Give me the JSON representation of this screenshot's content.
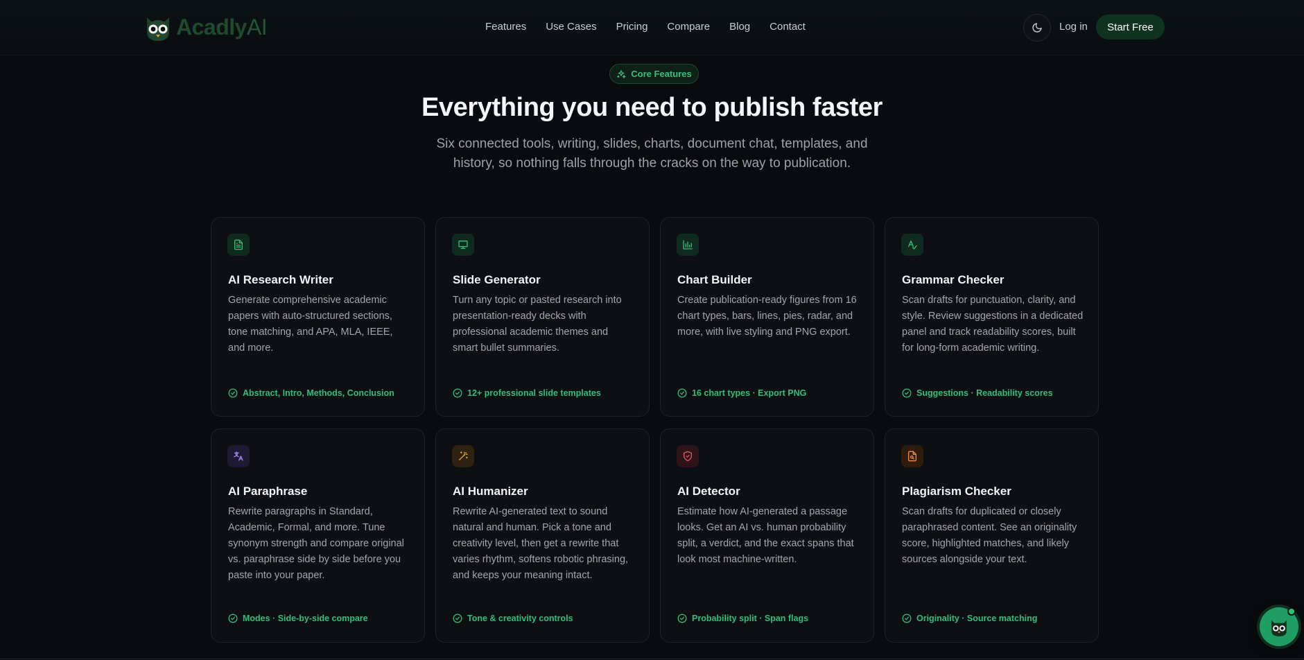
{
  "brand": {
    "name_main": "Acadly",
    "name_suffix": "AI"
  },
  "nav": {
    "items": [
      {
        "label": "Features"
      },
      {
        "label": "Use Cases"
      },
      {
        "label": "Pricing"
      },
      {
        "label": "Compare"
      },
      {
        "label": "Blog"
      },
      {
        "label": "Contact"
      }
    ],
    "login_label": "Log in",
    "start_label": "Start Free",
    "theme_icon": "moon-icon"
  },
  "hero": {
    "badge": "Core Features",
    "title": "Everything you need to publish faster",
    "subtitle": "Six connected tools, writing, slides, charts, document chat, templates, and history, so nothing falls through the cracks on the way to publication."
  },
  "colors": {
    "accent": "#2fbf7a",
    "primary_button": "#0f3320",
    "background": "#090b0d",
    "card_bg": "#0d0f12"
  },
  "features": [
    {
      "icon": "document-icon",
      "title": "AI Research Writer",
      "description": "Generate comprehensive academic papers with auto-structured sections, tone matching, and APA, MLA, IEEE, and more.",
      "tag": "Abstract, Intro, Methods, Conclusion"
    },
    {
      "icon": "presentation-icon",
      "title": "Slide Generator",
      "description": "Turn any topic or pasted research into presentation-ready decks with professional academic themes and smart bullet summaries.",
      "tag": "12+ professional slide templates"
    },
    {
      "icon": "bar-chart-icon",
      "title": "Chart Builder",
      "description": "Create publication-ready figures from 16 chart types, bars, lines, pies, radar, and more, with live styling and PNG export.",
      "tag": "16 chart types · Export PNG"
    },
    {
      "icon": "spell-check-icon",
      "title": "Grammar Checker",
      "description": "Scan drafts for punctuation, clarity, and style. Review suggestions in a dedicated panel and track readability scores, built for long-form academic writing.",
      "tag": "Suggestions · Readability scores"
    },
    {
      "icon": "translate-icon",
      "title": "AI Paraphrase",
      "description": "Rewrite paragraphs in Standard, Academic, Formal, and more. Tune synonym strength and compare original vs. paraphrase side by side before you paste into your paper.",
      "tag": "Modes · Side-by-side compare"
    },
    {
      "icon": "magic-wand-icon",
      "title": "AI Humanizer",
      "description": "Rewrite AI-generated text to sound natural and human. Pick a tone and creativity level, then get a rewrite that varies rhythm, softens robotic phrasing, and keeps your meaning intact.",
      "tag": "Tone & creativity controls"
    },
    {
      "icon": "shield-icon",
      "title": "AI Detector",
      "description": "Estimate how AI-generated a passage looks. Get an AI vs. human probability split, a verdict, and the exact spans that look most machine-written.",
      "tag": "Probability split · Span flags"
    },
    {
      "icon": "file-search-icon",
      "title": "Plagiarism Checker",
      "description": "Scan drafts for duplicated or closely paraphrased content. See an originality score, highlighted matches, and likely sources alongside your text.",
      "tag": "Originality · Source matching"
    }
  ]
}
